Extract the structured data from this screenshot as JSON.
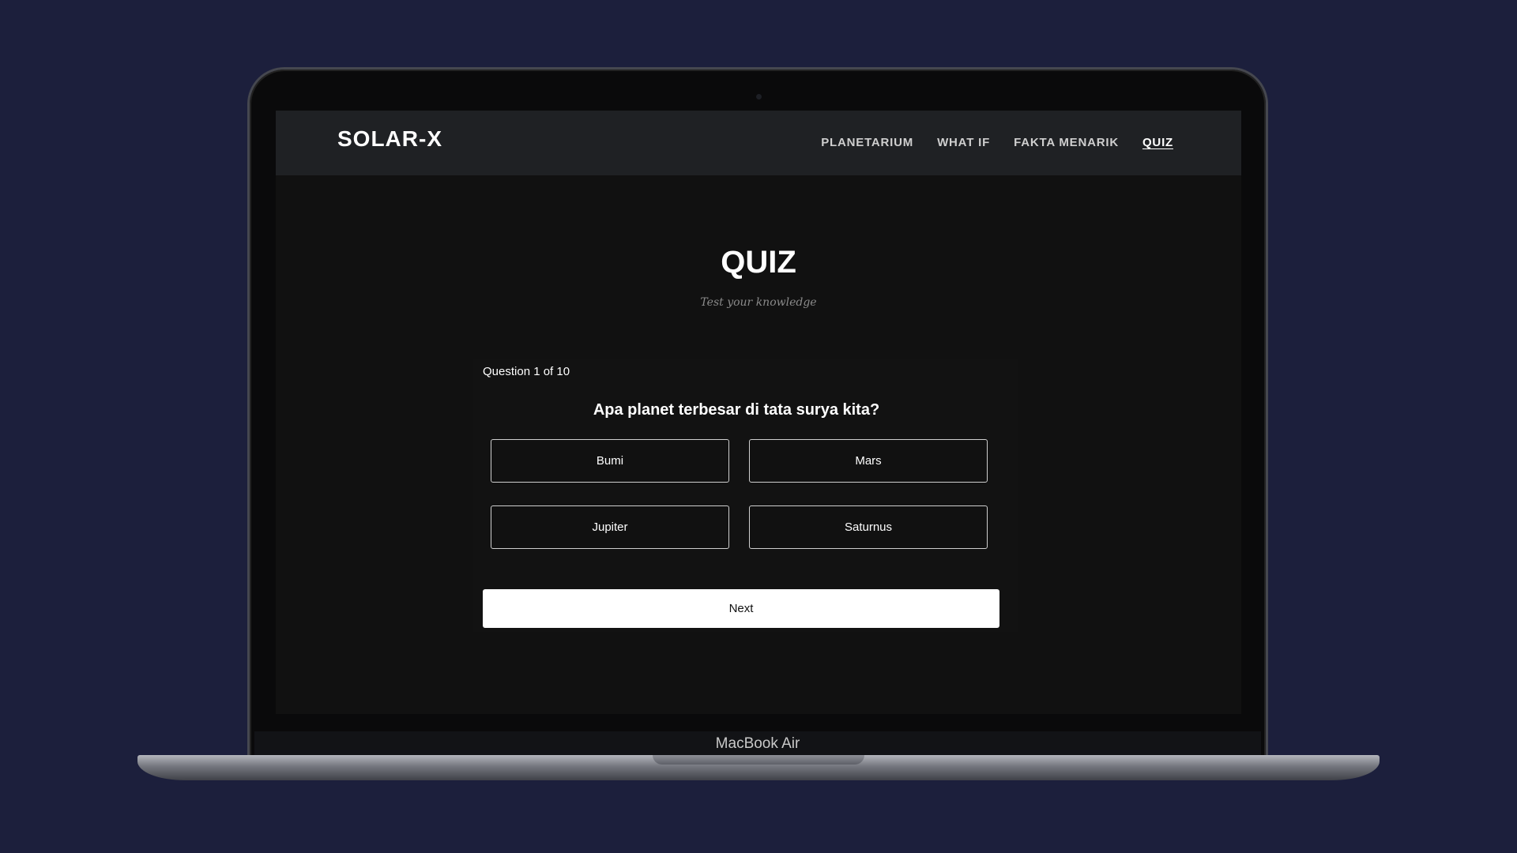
{
  "app": {
    "brand": "SOLAR-X"
  },
  "nav": {
    "items": [
      {
        "label": "PLANETARIUM",
        "active": false
      },
      {
        "label": "WHAT IF",
        "active": false
      },
      {
        "label": "FAKTA MENARIK",
        "active": false
      },
      {
        "label": "QUIZ",
        "active": true
      }
    ]
  },
  "hero": {
    "title": "QUIZ",
    "subtitle": "Test your knowledge"
  },
  "quiz": {
    "progress": "Question 1 of 10",
    "question": "Apa planet terbesar di tata surya kita?",
    "options": [
      "Bumi",
      "Mars",
      "Jupiter",
      "Saturnus"
    ],
    "next_label": "Next"
  },
  "device": {
    "label": "MacBook Air"
  },
  "colors": {
    "background": "#1c1f3c",
    "navbar": "#1f2124",
    "screen": "#111111",
    "accent": "#ffffff"
  }
}
